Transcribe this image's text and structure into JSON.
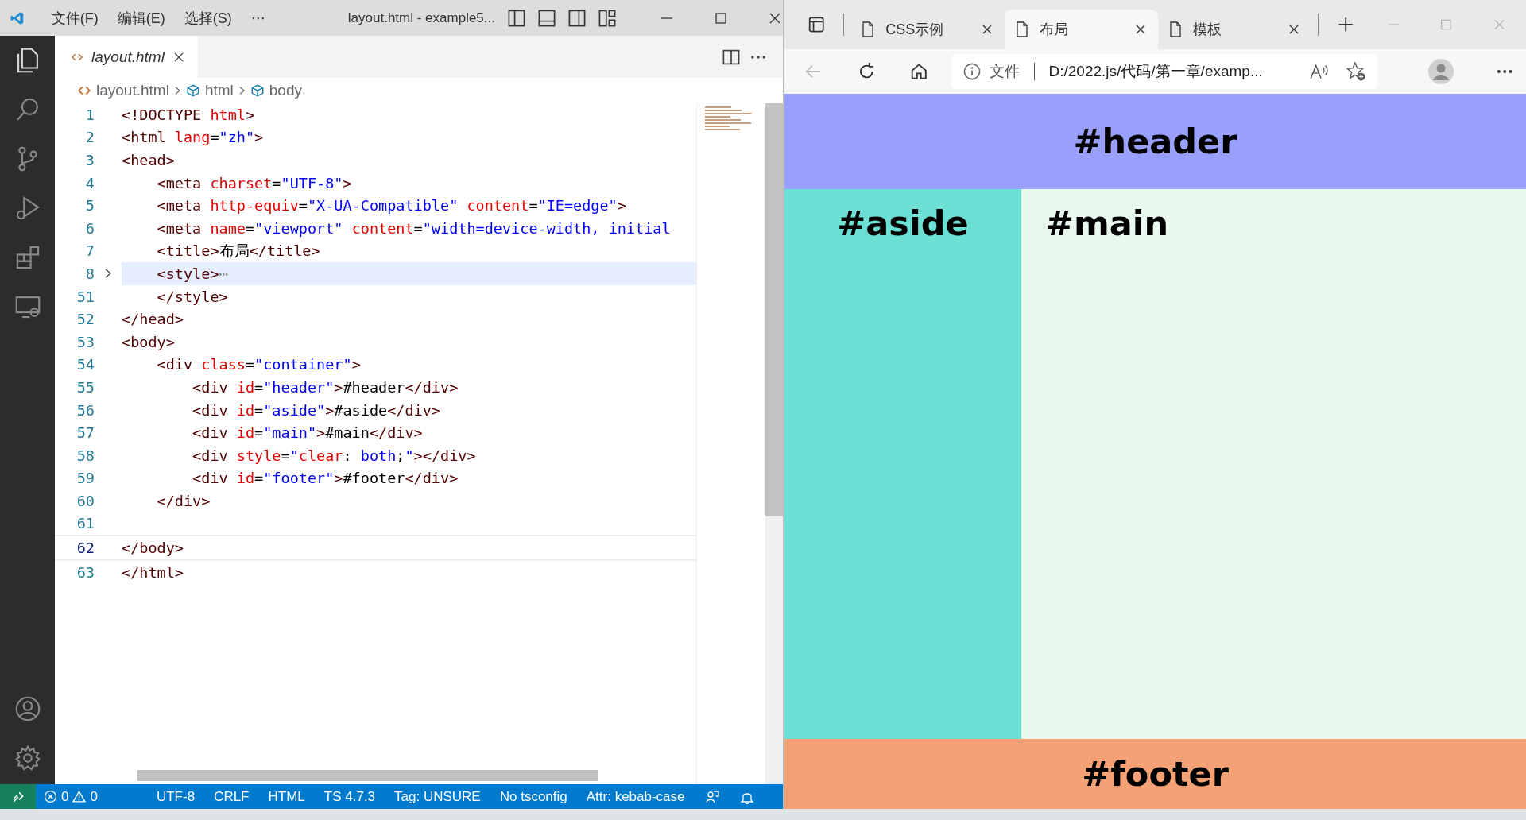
{
  "editor_window": {
    "menu": [
      "文件(F)",
      "编辑(E)",
      "选择(S)",
      "⋯"
    ],
    "title": "layout.html - example5...",
    "activity_bar": [
      {
        "kind": "files",
        "selected": true
      },
      {
        "kind": "search",
        "selected": false
      },
      {
        "kind": "source-control",
        "selected": false
      },
      {
        "kind": "run",
        "selected": false
      },
      {
        "kind": "extensions",
        "selected": false
      },
      {
        "kind": "remote",
        "selected": false
      }
    ],
    "activity_bar_bottom": [
      {
        "kind": "account"
      },
      {
        "kind": "settings"
      }
    ],
    "tab": {
      "label": "layout.html",
      "selected": true
    },
    "breadcrumb": [
      {
        "kind": "file",
        "label": "layout.html"
      },
      {
        "kind": "element",
        "label": "html"
      },
      {
        "kind": "element",
        "label": "body"
      }
    ],
    "code_lines": [
      {
        "number": "1",
        "folded": false,
        "current": false,
        "tokens": [
          {
            "kind": "tag",
            "text": "<!DOCTYPE "
          },
          {
            "kind": "attr",
            "text": "html"
          },
          {
            "kind": "tag",
            "text": ">"
          }
        ]
      },
      {
        "number": "2",
        "folded": false,
        "current": false,
        "tokens": [
          {
            "kind": "tag",
            "text": "<html "
          },
          {
            "kind": "attr",
            "text": "lang"
          },
          {
            "kind": "text",
            "text": "="
          },
          {
            "kind": "string",
            "text": "\"zh\""
          },
          {
            "kind": "tag",
            "text": ">"
          }
        ]
      },
      {
        "number": "3",
        "folded": false,
        "current": false,
        "tokens": [
          {
            "kind": "tag",
            "text": "<head>"
          }
        ]
      },
      {
        "number": "4",
        "folded": false,
        "current": false,
        "tokens": [
          {
            "kind": "tag",
            "text": "    <meta "
          },
          {
            "kind": "attr",
            "text": "charset"
          },
          {
            "kind": "text",
            "text": "="
          },
          {
            "kind": "string",
            "text": "\"UTF-8\""
          },
          {
            "kind": "tag",
            "text": ">"
          }
        ]
      },
      {
        "number": "5",
        "folded": false,
        "current": false,
        "tokens": [
          {
            "kind": "tag",
            "text": "    <meta "
          },
          {
            "kind": "attr",
            "text": "http-equiv"
          },
          {
            "kind": "text",
            "text": "="
          },
          {
            "kind": "string",
            "text": "\"X-UA-Compatible\" "
          },
          {
            "kind": "attr",
            "text": "content"
          },
          {
            "kind": "text",
            "text": "="
          },
          {
            "kind": "string",
            "text": "\"IE=edge\""
          },
          {
            "kind": "tag",
            "text": ">"
          }
        ]
      },
      {
        "number": "6",
        "folded": false,
        "current": false,
        "tokens": [
          {
            "kind": "tag",
            "text": "    <meta "
          },
          {
            "kind": "attr",
            "text": "name"
          },
          {
            "kind": "text",
            "text": "="
          },
          {
            "kind": "string",
            "text": "\"viewport\" "
          },
          {
            "kind": "attr",
            "text": "content"
          },
          {
            "kind": "text",
            "text": "="
          },
          {
            "kind": "string",
            "text": "\"width=device-width, initial"
          }
        ]
      },
      {
        "number": "7",
        "folded": false,
        "current": false,
        "tokens": [
          {
            "kind": "tag",
            "text": "    <title>"
          },
          {
            "kind": "text",
            "text": "布局"
          },
          {
            "kind": "tag",
            "text": "</title>"
          }
        ]
      },
      {
        "number": "8",
        "folded": true,
        "current": false,
        "tokens": [
          {
            "kind": "tag",
            "text": "    <style>"
          },
          {
            "kind": "fold",
            "text": "⋯"
          }
        ]
      },
      {
        "number": "51",
        "folded": false,
        "current": false,
        "tokens": [
          {
            "kind": "tag",
            "text": "    </style>"
          }
        ]
      },
      {
        "number": "52",
        "folded": false,
        "current": false,
        "tokens": [
          {
            "kind": "tag",
            "text": "</head>"
          }
        ]
      },
      {
        "number": "53",
        "folded": false,
        "current": false,
        "tokens": [
          {
            "kind": "tag",
            "text": "<body>"
          }
        ]
      },
      {
        "number": "54",
        "folded": false,
        "current": false,
        "tokens": [
          {
            "kind": "tag",
            "text": "    <div "
          },
          {
            "kind": "attr",
            "text": "class"
          },
          {
            "kind": "text",
            "text": "="
          },
          {
            "kind": "string",
            "text": "\"container\""
          },
          {
            "kind": "tag",
            "text": ">"
          }
        ]
      },
      {
        "number": "55",
        "folded": false,
        "current": false,
        "tokens": [
          {
            "kind": "tag",
            "text": "        <div "
          },
          {
            "kind": "attr",
            "text": "id"
          },
          {
            "kind": "text",
            "text": "="
          },
          {
            "kind": "string",
            "text": "\"header\""
          },
          {
            "kind": "tag",
            "text": ">"
          },
          {
            "kind": "text",
            "text": "#header"
          },
          {
            "kind": "tag",
            "text": "</div>"
          }
        ]
      },
      {
        "number": "56",
        "folded": false,
        "current": false,
        "tokens": [
          {
            "kind": "tag",
            "text": "        <div "
          },
          {
            "kind": "attr",
            "text": "id"
          },
          {
            "kind": "text",
            "text": "="
          },
          {
            "kind": "string",
            "text": "\"aside\""
          },
          {
            "kind": "tag",
            "text": ">"
          },
          {
            "kind": "text",
            "text": "#aside"
          },
          {
            "kind": "tag",
            "text": "</div>"
          }
        ]
      },
      {
        "number": "57",
        "folded": false,
        "current": false,
        "tokens": [
          {
            "kind": "tag",
            "text": "        <div "
          },
          {
            "kind": "attr",
            "text": "id"
          },
          {
            "kind": "text",
            "text": "="
          },
          {
            "kind": "string",
            "text": "\"main\""
          },
          {
            "kind": "tag",
            "text": ">"
          },
          {
            "kind": "text",
            "text": "#main"
          },
          {
            "kind": "tag",
            "text": "</div>"
          }
        ]
      },
      {
        "number": "58",
        "folded": false,
        "current": false,
        "tokens": [
          {
            "kind": "tag",
            "text": "        <div "
          },
          {
            "kind": "attr",
            "text": "style"
          },
          {
            "kind": "text",
            "text": "="
          },
          {
            "kind": "string",
            "text": "\""
          },
          {
            "kind": "attr",
            "text": "clear"
          },
          {
            "kind": "text",
            "text": ": "
          },
          {
            "kind": "string",
            "text": "both"
          },
          {
            "kind": "text",
            "text": ";"
          },
          {
            "kind": "string",
            "text": "\""
          },
          {
            "kind": "tag",
            "text": "></div>"
          }
        ]
      },
      {
        "number": "59",
        "folded": false,
        "current": false,
        "tokens": [
          {
            "kind": "tag",
            "text": "        <div "
          },
          {
            "kind": "attr",
            "text": "id"
          },
          {
            "kind": "text",
            "text": "="
          },
          {
            "kind": "string",
            "text": "\"footer\""
          },
          {
            "kind": "tag",
            "text": ">"
          },
          {
            "kind": "text",
            "text": "#footer"
          },
          {
            "kind": "tag",
            "text": "</div>"
          }
        ]
      },
      {
        "number": "60",
        "folded": false,
        "current": false,
        "tokens": [
          {
            "kind": "tag",
            "text": "    </div>"
          }
        ]
      },
      {
        "number": "61",
        "folded": false,
        "current": false
      },
      {
        "number": "62",
        "folded": false,
        "current": true,
        "tokens": [
          {
            "kind": "tag",
            "text": "</body>"
          }
        ]
      },
      {
        "number": "63",
        "folded": false,
        "current": false,
        "tokens": [
          {
            "kind": "tag",
            "text": "</html>"
          }
        ]
      }
    ],
    "status_bar": {
      "errors": "0",
      "warnings": "0",
      "items": [
        "UTF-8",
        "CRLF",
        "HTML",
        "TS 4.7.3",
        "Tag: UNSURE",
        "No tsconfig",
        "Attr: kebab-case"
      ]
    }
  },
  "browser_window": {
    "tabs": [
      {
        "label": "CSS示例",
        "selected": false
      },
      {
        "label": "布局",
        "selected": true
      },
      {
        "label": "模板",
        "selected": false
      }
    ],
    "address": {
      "scheme": "文件",
      "url": "D:/2022.js/代码/第一章/examp..."
    },
    "page": {
      "header": "#header",
      "aside": "#aside",
      "main": "#main",
      "footer": "#footer"
    }
  }
}
